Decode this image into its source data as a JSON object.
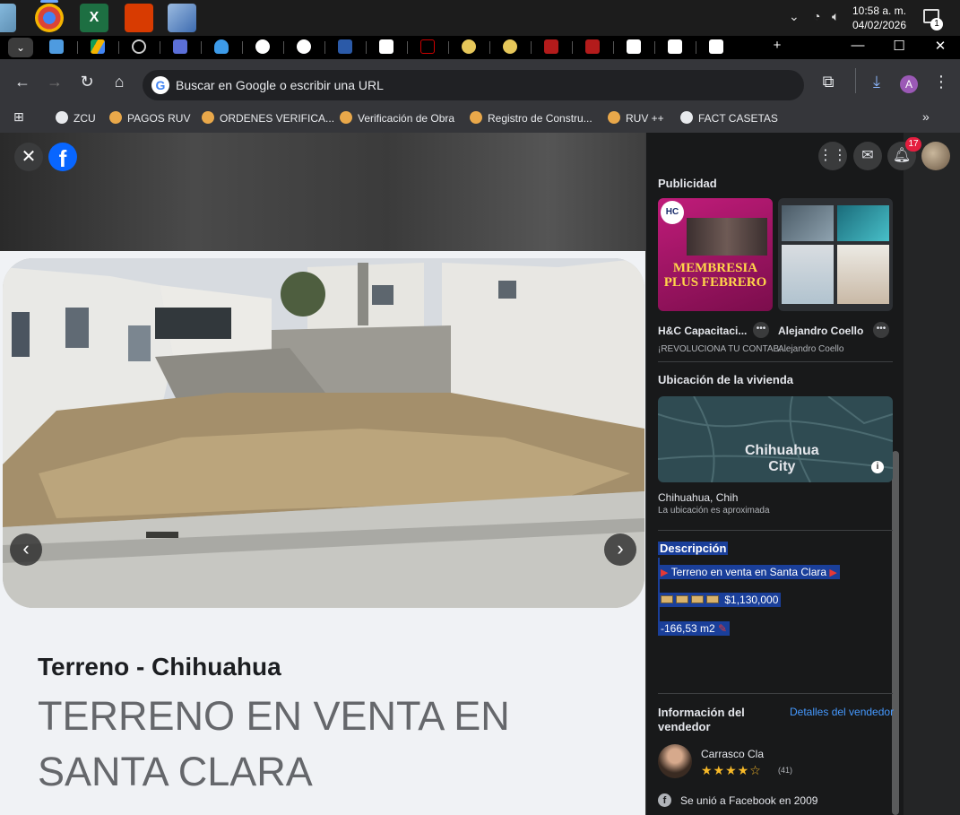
{
  "taskbar": {
    "time": "10:58 a. m.",
    "date": "04/02/2026",
    "notification_count": "1"
  },
  "tabs": {
    "new_tab": "+",
    "minimize": "—",
    "maximize": "☐",
    "close": "✕"
  },
  "toolbar": {
    "omnibox_placeholder": "Buscar en Google o escribir una URL",
    "profile_initial": "A"
  },
  "bookmarks": [
    {
      "label": "ZCU"
    },
    {
      "label": "PAGOS RUV"
    },
    {
      "label": "ORDENES VERIFICA..."
    },
    {
      "label": "Verificación de Obra"
    },
    {
      "label": "Registro de Constru..."
    },
    {
      "label": "RUV ++"
    },
    {
      "label": "FACT CASETAS"
    }
  ],
  "header": {
    "notification_badge": "17"
  },
  "listing": {
    "category": "Terreno - Chihuahua",
    "title": "TERRENO EN VENTA EN SANTA CLARA"
  },
  "ads": {
    "heading": "Publicidad",
    "items": [
      {
        "name": "H&C Capacitaci...",
        "sub": "¡REVOLUCIONA TU CONTAB...",
        "banner_line1": "MEMBRESIA",
        "banner_line2": "PLUS FEBRERO"
      },
      {
        "name": "Alejandro Coello",
        "sub": "Alejandro Coello"
      }
    ]
  },
  "location": {
    "heading": "Ubicación de la vivienda",
    "map_label_line1": "Chihuahua",
    "map_label_line2": "City",
    "place": "Chihuahua, Chih",
    "note": "La ubicación es aproximada"
  },
  "description": {
    "heading": "Descripción",
    "line1": "Terreno en venta en Santa Clara",
    "price": "$1,130,000",
    "area": "-166,53 m2"
  },
  "seller": {
    "heading": "Información del vendedor",
    "details_link": "Detalles del vendedor",
    "name": "Carrasco Cla",
    "rating_count": "(41)",
    "joined": "Se unió a Facebook en 2009"
  },
  "colors": {
    "accent_link": "#4599ff",
    "selection": "#1a3f9a",
    "facebook_blue": "#0866ff",
    "badge_red": "#e41e3f"
  }
}
